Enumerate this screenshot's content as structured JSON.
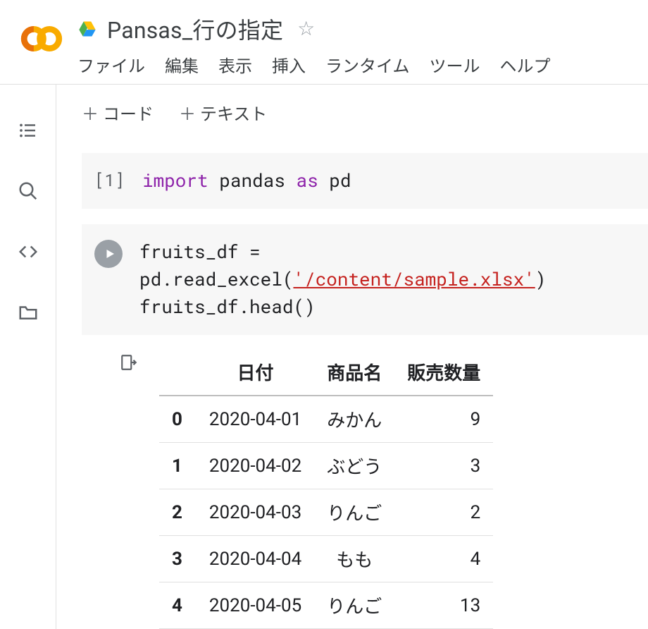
{
  "header": {
    "title": "Pansas_行の指定",
    "menu": [
      "ファイル",
      "編集",
      "表示",
      "挿入",
      "ランタイム",
      "ツール",
      "ヘルプ"
    ]
  },
  "toolbar": {
    "code_label": "コード",
    "text_label": "テキスト",
    "plus": "＋"
  },
  "cells": [
    {
      "num": "[1]",
      "code_parts": {
        "import": "import",
        "module": "pandas",
        "as": "as",
        "alias": "pd"
      }
    },
    {
      "code_line1_prefix": "fruits_df = pd.read_excel(",
      "code_line1_str": "'/content/sample.xlsx'",
      "code_line1_suffix": ")",
      "code_line2": "fruits_df.head()"
    }
  ],
  "output": {
    "columns": [
      "日付",
      "商品名",
      "販売数量"
    ],
    "rows": [
      {
        "idx": "0",
        "date": "2020-04-01",
        "name": "みかん",
        "qty": "9"
      },
      {
        "idx": "1",
        "date": "2020-04-02",
        "name": "ぶどう",
        "qty": "3"
      },
      {
        "idx": "2",
        "date": "2020-04-03",
        "name": "りんご",
        "qty": "2"
      },
      {
        "idx": "3",
        "date": "2020-04-04",
        "name": "もも",
        "qty": "4"
      },
      {
        "idx": "4",
        "date": "2020-04-05",
        "name": "りんご",
        "qty": "13"
      }
    ]
  }
}
